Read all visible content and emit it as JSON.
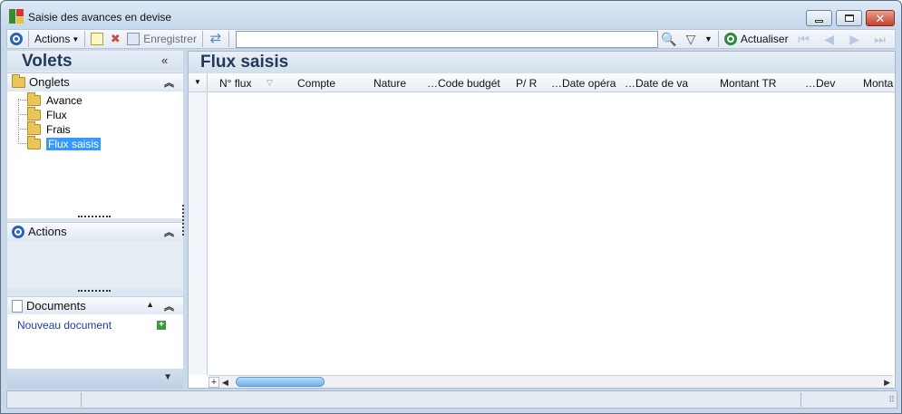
{
  "window": {
    "title": "Saisie des avances en devise"
  },
  "toolbar": {
    "actions_label": "Actions",
    "save_label": "Enregistrer",
    "search_value": "",
    "refresh_label": "Actualiser"
  },
  "left": {
    "title": "Volets",
    "onglets": {
      "label": "Onglets",
      "items": [
        {
          "label": "Avance"
        },
        {
          "label": "Flux"
        },
        {
          "label": "Frais"
        },
        {
          "label": "Flux saisis",
          "selected": true
        }
      ]
    },
    "actions": {
      "label": "Actions"
    },
    "documents": {
      "label": "Documents",
      "new_document": "Nouveau document"
    }
  },
  "main": {
    "title": "Flux saisis",
    "columns": [
      "N° flux",
      "Compte",
      "Nature",
      "…Code budgét",
      "P/ R",
      "…Date opéra",
      "…Date de va",
      "Montant TR",
      "…Dev",
      "Monta"
    ],
    "rows": []
  }
}
